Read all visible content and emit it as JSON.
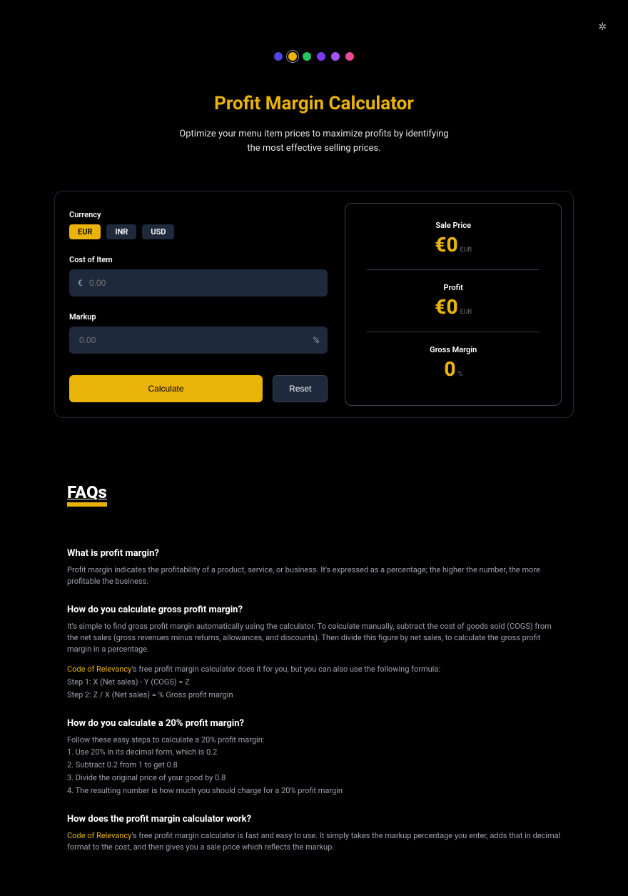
{
  "header": {
    "title": "Profit Margin Calculator",
    "subtitle": "Optimize your menu item prices to maximize profits by identifying the most effective selling prices."
  },
  "theme_icon": "✲",
  "currency": {
    "label": "Currency",
    "options": [
      "EUR",
      "INR",
      "USD"
    ],
    "selected": "EUR",
    "symbol": "€"
  },
  "inputs": {
    "cost_label": "Cost of Item",
    "cost_placeholder": "0.00",
    "markup_label": "Markup",
    "markup_placeholder": "0.00",
    "percent_symbol": "%"
  },
  "buttons": {
    "calculate": "Calculate",
    "reset": "Reset"
  },
  "results": {
    "sale_price": {
      "label": "Sale Price",
      "value": "€0",
      "unit": "EUR"
    },
    "profit": {
      "label": "Profit",
      "value": "€0",
      "unit": "EUR"
    },
    "gross_margin": {
      "label": "Gross Margin",
      "value": "0",
      "unit": "%"
    }
  },
  "faqs": {
    "heading": "FAQs",
    "brand": "Code of Relevancy",
    "items": [
      {
        "q": "What is profit margin?",
        "a": "Profit margin indicates the profitability of a product, service, or business. It's expressed as a percentage; the higher the number, the more profitable the business."
      },
      {
        "q": "How do you calculate gross profit margin?",
        "a1": "It's simple to find gross profit margin automatically using the calculator. To calculate manually, subtract the cost of goods sold (COGS) from the net sales (gross revenues minus returns, allowances, and discounts). Then divide this figure by net sales, to calculate the gross profit margin in a percentage.",
        "a2_tail": "'s free profit margin calculator does it for you, but you can also use the following formula:",
        "step1": "Step 1: X (Net sales) - Y (COGS) = Z",
        "step2": "Step 2: Z / X (Net sales) = % Gross profit margin"
      },
      {
        "q": "How do you calculate a 20% profit margin?",
        "intro": "Follow these easy steps to calculate a 20% profit margin:",
        "s1": "1. Use 20% in its decimal form, which is 0.2",
        "s2": "2. Subtract 0.2 from 1 to get 0.8",
        "s3": "3. Divide the original price of your good by 0.8",
        "s4": "4. The resulting number is how much you should charge for a 20% profit margin"
      },
      {
        "q": "How does the profit margin calculator work?",
        "a_tail": "'s free profit margin calculator is fast and easy to use. It simply takes the markup percentage you enter, adds that in decimal format to the cost, and then gives you a sale price which reflects the markup."
      }
    ]
  }
}
